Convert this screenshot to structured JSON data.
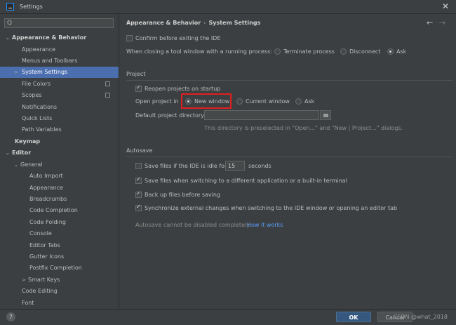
{
  "window": {
    "title": "Settings",
    "close_glyph": "✕"
  },
  "search": {
    "value": "",
    "icon": "Q"
  },
  "sidebar": {
    "items": [
      {
        "label": "Appearance & Behavior",
        "arrow": "⌄"
      },
      {
        "label": "Appearance"
      },
      {
        "label": "Menus and Toolbars"
      },
      {
        "label": "System Settings",
        "arrow": ">"
      },
      {
        "label": "File Colors"
      },
      {
        "label": "Scopes"
      },
      {
        "label": "Notifications"
      },
      {
        "label": "Quick Lists"
      },
      {
        "label": "Path Variables"
      },
      {
        "label": "Keymap"
      },
      {
        "label": "Editor",
        "arrow": "⌄"
      },
      {
        "label": "General",
        "arrow": "⌄"
      },
      {
        "label": "Auto Import"
      },
      {
        "label": "Appearance"
      },
      {
        "label": "Breadcrumbs"
      },
      {
        "label": "Code Completion"
      },
      {
        "label": "Code Folding"
      },
      {
        "label": "Console"
      },
      {
        "label": "Editor Tabs"
      },
      {
        "label": "Gutter Icons"
      },
      {
        "label": "Postfix Completion"
      },
      {
        "label": "Smart Keys",
        "arrow": ">"
      },
      {
        "label": "Code Editing"
      },
      {
        "label": "Font"
      }
    ]
  },
  "breadcrumb": {
    "parent": "Appearance & Behavior",
    "sep": "›",
    "current": "System Settings",
    "back": "←",
    "forward": "→"
  },
  "general": {
    "confirm_exit": "Confirm before exiting the IDE",
    "tool_window_label": "When closing a tool window with a running process:",
    "terminate": "Terminate process",
    "disconnect": "Disconnect",
    "ask": "Ask"
  },
  "project": {
    "title": "Project",
    "reopen": "Reopen projects on startup",
    "open_label": "Open project in",
    "new_window": "New window",
    "current_window": "Current window",
    "ask": "Ask",
    "default_dir_label": "Default project directory:",
    "default_dir_value": "",
    "hint": "This directory is preselected in \"Open...\" and \"New | Project...\" dialogs."
  },
  "autosave": {
    "title": "Autosave",
    "idle_prefix": "Save files if the IDE is idle for",
    "idle_value": "15",
    "idle_suffix": "seconds",
    "switch_app": "Save files when switching to a different application or a built-in terminal",
    "backup": "Back up files before saving",
    "sync": "Synchronize external changes when switching to the IDE window or opening an editor tab",
    "note": "Autosave cannot be disabled completely.",
    "how_link": "How it works"
  },
  "footer": {
    "help": "?",
    "ok": "OK",
    "cancel": "Cancel",
    "watermark": "CSDN @what_2018"
  },
  "colors": {
    "selection": "#4b6eaf",
    "highlight": "#e02020",
    "primary": "#365880",
    "link": "#589df6"
  }
}
